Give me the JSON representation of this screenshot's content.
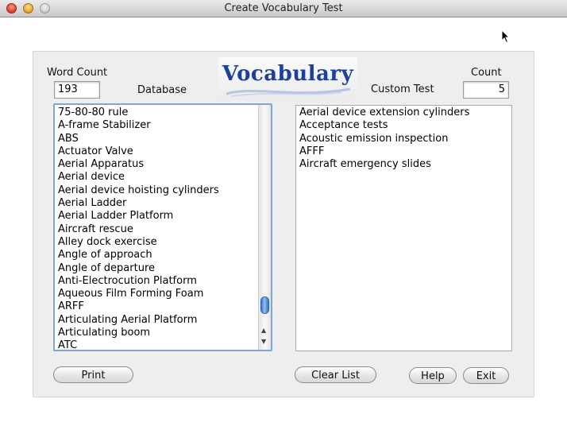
{
  "window": {
    "title": "Create Vocabulary Test"
  },
  "logo": {
    "text": "Vocabulary"
  },
  "database": {
    "word_count_label": "Word Count",
    "word_count_value": "193",
    "label": "Database",
    "items": [
      "75-80-80 rule",
      "A-frame Stabilizer",
      "ABS",
      "Actuator Valve",
      "Aerial Apparatus",
      "Aerial device",
      "Aerial device hoisting cylinders",
      "Aerial Ladder",
      "Aerial Ladder Platform",
      "Aircraft rescue",
      "Alley dock exercise",
      "Angle of approach",
      "Angle of departure",
      "Anti-Electrocution Platform",
      "Aqueous Film Forming Foam",
      "ARFF",
      "Articulating Aerial Platform",
      "Articulating boom",
      "ATC"
    ]
  },
  "custom_test": {
    "label": "Custom Test",
    "count_label": "Count",
    "count_value": "5",
    "items": [
      "Aerial device extension cylinders",
      "Acceptance tests",
      "Acoustic emission inspection",
      "AFFF",
      "Aircraft emergency slides"
    ]
  },
  "buttons": {
    "print": "Print",
    "clear_list": "Clear List",
    "help": "Help",
    "exit": "Exit"
  },
  "icons": {
    "close": "close-button-icon",
    "minimize": "minimize-button-icon",
    "zoom": "zoom-button-icon",
    "cursor": "mouse-pointer-icon",
    "scroll_up": "scroll-up-arrow-icon",
    "scroll_down": "scroll-down-arrow-icon"
  }
}
